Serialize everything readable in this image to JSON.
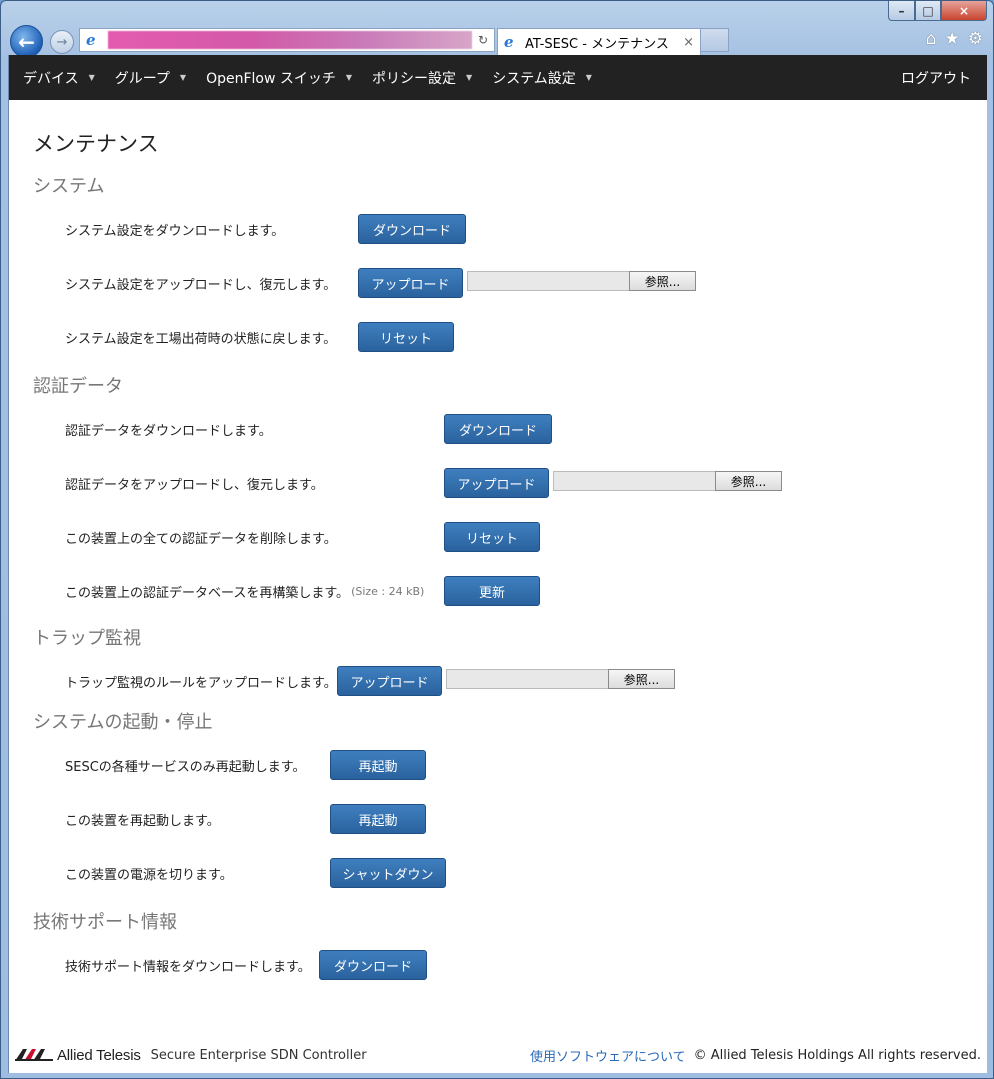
{
  "browser": {
    "tab_title": "AT-SESC - メンテナンス",
    "tab_close": "×",
    "window_min": "–",
    "window_max": "□",
    "window_close": "×"
  },
  "navbar": {
    "menus": [
      "デバイス",
      "グループ",
      "OpenFlow スイッチ",
      "ポリシー設定",
      "システム設定"
    ],
    "logout": "ログアウト"
  },
  "page": {
    "title": "メンテナンス"
  },
  "sections": {
    "system": {
      "title": "システム",
      "download_label": "システム設定をダウンロードします。",
      "download_button": "ダウンロード",
      "upload_label": "システム設定をアップロードし、復元します。",
      "upload_button": "アップロード",
      "browse_button": "参照...",
      "reset_label": "システム設定を工場出荷時の状態に戻します。",
      "reset_button": "リセット"
    },
    "auth": {
      "title": "認証データ",
      "download_label": "認証データをダウンロードします。",
      "download_button": "ダウンロード",
      "upload_label": "認証データをアップロードし、復元します。",
      "upload_button": "アップロード",
      "browse_button": "参照...",
      "delete_label": "この装置上の全ての認証データを削除します。",
      "delete_button": "リセット",
      "rebuild_label": "この装置上の認証データベースを再構築します。",
      "rebuild_size": "(Size : 24 kB)",
      "rebuild_button": "更新"
    },
    "trap": {
      "title": "トラップ監視",
      "upload_label": "トラップ監視のルールをアップロードします。",
      "upload_button": "アップロード",
      "browse_button": "参照..."
    },
    "startstop": {
      "title": "システムの起動・停止",
      "service_label": "SESCの各種サービスのみ再起動します。",
      "service_button": "再起動",
      "reboot_label": "この装置を再起動します。",
      "reboot_button": "再起動",
      "shutdown_label": "この装置の電源を切ります。",
      "shutdown_button": "シャットダウン"
    },
    "support": {
      "title": "技術サポート情報",
      "download_label": "技術サポート情報をダウンロードします。",
      "download_button": "ダウンロード"
    }
  },
  "footer": {
    "brand": "Allied Telesis",
    "product": "Secure Enterprise SDN Controller",
    "software_link": "使用ソフトウェアについて",
    "copyright": "© Allied Telesis Holdings All rights reserved."
  },
  "colors": {
    "navbar_bg": "#222222",
    "button_bg": "#2f6aa8",
    "section_title": "#777777",
    "link": "#2a6ab6"
  }
}
